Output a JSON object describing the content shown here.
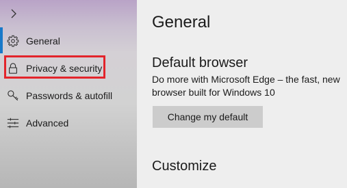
{
  "sidebar": {
    "expand_icon": "chevron-right-icon",
    "items": [
      {
        "label": "General",
        "icon": "gear-icon"
      },
      {
        "label": "Privacy & security",
        "icon": "lock-icon"
      },
      {
        "label": "Passwords & autofill",
        "icon": "key-icon"
      },
      {
        "label": "Advanced",
        "icon": "sliders-icon"
      }
    ],
    "active_index": 0,
    "highlighted_index": 1
  },
  "main": {
    "title": "General",
    "default_browser": {
      "heading": "Default browser",
      "description": "Do more with Microsoft Edge – the fast, new browser built for Windows 10",
      "button_label": "Change my default"
    },
    "customize": {
      "heading": "Customize"
    }
  },
  "colors": {
    "accent": "#1979c9",
    "highlight_border": "#e3242b",
    "button_bg": "#cccccc",
    "main_bg": "#eeeeee"
  }
}
